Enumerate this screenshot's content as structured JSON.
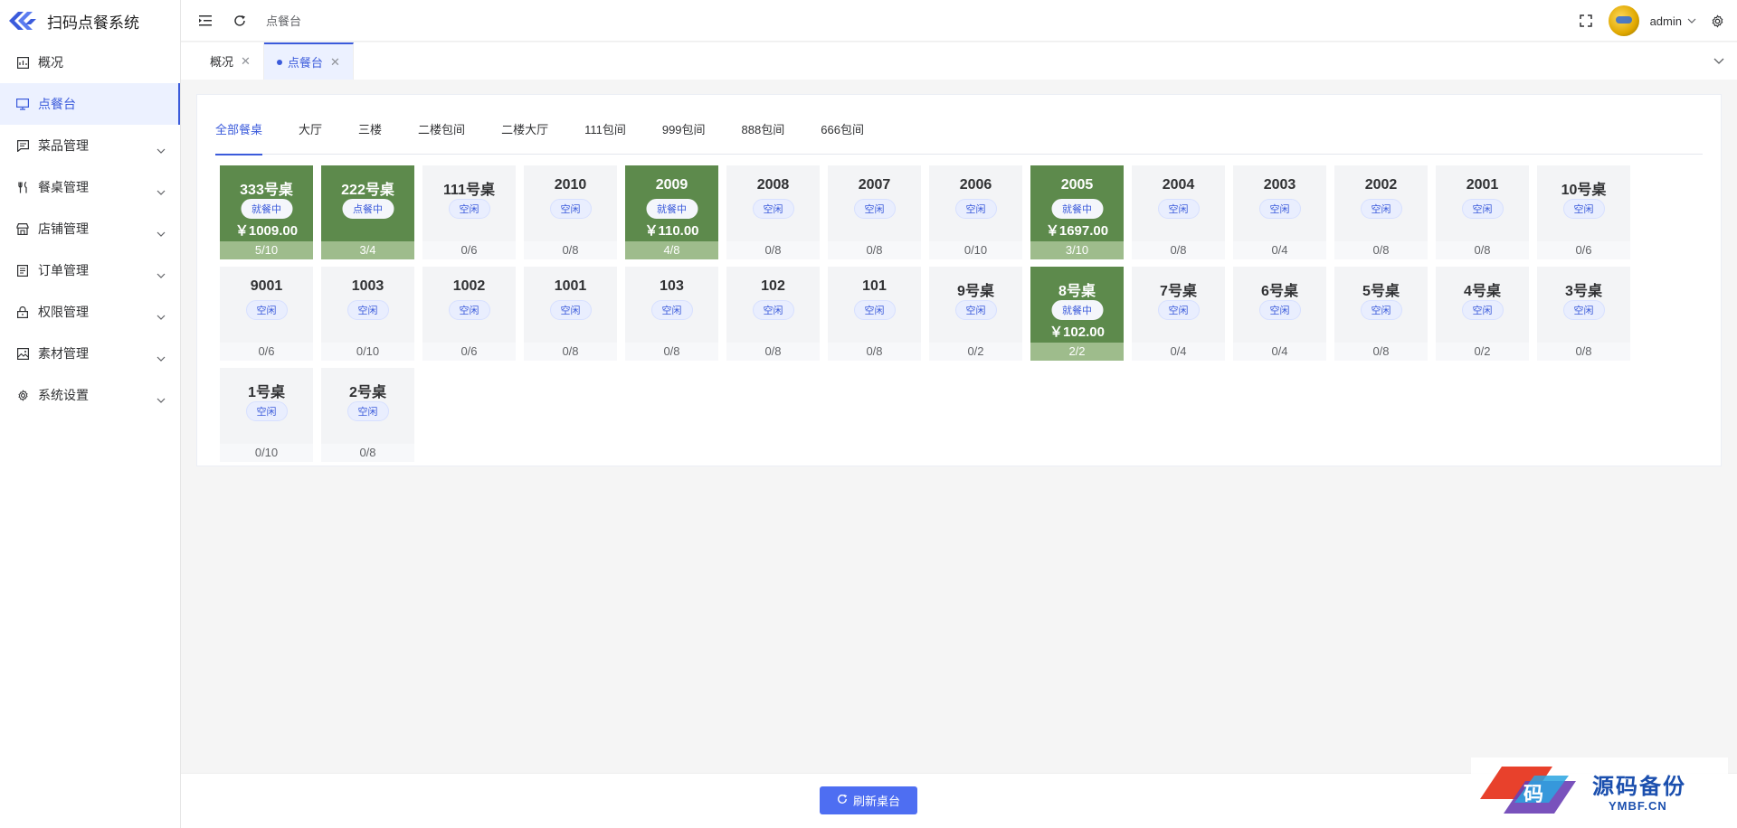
{
  "app": {
    "title": "扫码点餐系统"
  },
  "sidebar": {
    "items": [
      {
        "label": "概况",
        "icon": "dashboard-icon",
        "expandable": false,
        "active": false
      },
      {
        "label": "点餐台",
        "icon": "monitor-icon",
        "expandable": false,
        "active": true
      },
      {
        "label": "菜品管理",
        "icon": "menu-list-icon",
        "expandable": true,
        "active": false
      },
      {
        "label": "餐桌管理",
        "icon": "fork-knife-icon",
        "expandable": true,
        "active": false
      },
      {
        "label": "店铺管理",
        "icon": "shop-icon",
        "expandable": true,
        "active": false
      },
      {
        "label": "订单管理",
        "icon": "order-icon",
        "expandable": true,
        "active": false
      },
      {
        "label": "权限管理",
        "icon": "lock-icon",
        "expandable": true,
        "active": false
      },
      {
        "label": "素材管理",
        "icon": "image-icon",
        "expandable": true,
        "active": false
      },
      {
        "label": "系统设置",
        "icon": "gear-icon",
        "expandable": true,
        "active": false
      }
    ]
  },
  "header": {
    "breadcrumb": "点餐台",
    "username": "admin"
  },
  "tabs": [
    {
      "label": "概况",
      "active": false
    },
    {
      "label": "点餐台",
      "active": true
    }
  ],
  "areas": [
    "全部餐桌",
    "大厅",
    "三楼",
    "二楼包间",
    "二楼大厅",
    "111包间",
    "999包间",
    "888包间",
    "666包间"
  ],
  "active_area": "全部餐桌",
  "tables": [
    {
      "name": "333号桌",
      "status": "就餐中",
      "amount": "￥1009.00",
      "seats": "5/10",
      "busy": true
    },
    {
      "name": "222号桌",
      "status": "点餐中",
      "amount": "",
      "seats": "3/4",
      "busy": true
    },
    {
      "name": "111号桌",
      "status": "空闲",
      "amount": "",
      "seats": "0/6",
      "busy": false
    },
    {
      "name": "2010",
      "status": "空闲",
      "amount": "",
      "seats": "0/8",
      "busy": false
    },
    {
      "name": "2009",
      "status": "就餐中",
      "amount": "￥110.00",
      "seats": "4/8",
      "busy": true
    },
    {
      "name": "2008",
      "status": "空闲",
      "amount": "",
      "seats": "0/8",
      "busy": false
    },
    {
      "name": "2007",
      "status": "空闲",
      "amount": "",
      "seats": "0/8",
      "busy": false
    },
    {
      "name": "2006",
      "status": "空闲",
      "amount": "",
      "seats": "0/10",
      "busy": false
    },
    {
      "name": "2005",
      "status": "就餐中",
      "amount": "￥1697.00",
      "seats": "3/10",
      "busy": true
    },
    {
      "name": "2004",
      "status": "空闲",
      "amount": "",
      "seats": "0/8",
      "busy": false
    },
    {
      "name": "2003",
      "status": "空闲",
      "amount": "",
      "seats": "0/4",
      "busy": false
    },
    {
      "name": "2002",
      "status": "空闲",
      "amount": "",
      "seats": "0/8",
      "busy": false
    },
    {
      "name": "2001",
      "status": "空闲",
      "amount": "",
      "seats": "0/8",
      "busy": false
    },
    {
      "name": "10号桌",
      "status": "空闲",
      "amount": "",
      "seats": "0/6",
      "busy": false
    },
    {
      "name": "9001",
      "status": "空闲",
      "amount": "",
      "seats": "0/6",
      "busy": false
    },
    {
      "name": "1003",
      "status": "空闲",
      "amount": "",
      "seats": "0/10",
      "busy": false
    },
    {
      "name": "1002",
      "status": "空闲",
      "amount": "",
      "seats": "0/6",
      "busy": false
    },
    {
      "name": "1001",
      "status": "空闲",
      "amount": "",
      "seats": "0/8",
      "busy": false
    },
    {
      "name": "103",
      "status": "空闲",
      "amount": "",
      "seats": "0/8",
      "busy": false
    },
    {
      "name": "102",
      "status": "空闲",
      "amount": "",
      "seats": "0/8",
      "busy": false
    },
    {
      "name": "101",
      "status": "空闲",
      "amount": "",
      "seats": "0/8",
      "busy": false
    },
    {
      "name": "9号桌",
      "status": "空闲",
      "amount": "",
      "seats": "0/2",
      "busy": false
    },
    {
      "name": "8号桌",
      "status": "就餐中",
      "amount": "￥102.00",
      "seats": "2/2",
      "busy": true
    },
    {
      "name": "7号桌",
      "status": "空闲",
      "amount": "",
      "seats": "0/4",
      "busy": false
    },
    {
      "name": "6号桌",
      "status": "空闲",
      "amount": "",
      "seats": "0/4",
      "busy": false
    },
    {
      "name": "5号桌",
      "status": "空闲",
      "amount": "",
      "seats": "0/8",
      "busy": false
    },
    {
      "name": "4号桌",
      "status": "空闲",
      "amount": "",
      "seats": "0/2",
      "busy": false
    },
    {
      "name": "3号桌",
      "status": "空闲",
      "amount": "",
      "seats": "0/8",
      "busy": false
    },
    {
      "name": "1号桌",
      "status": "空闲",
      "amount": "",
      "seats": "0/10",
      "busy": false
    },
    {
      "name": "2号桌",
      "status": "空闲",
      "amount": "",
      "seats": "0/8",
      "busy": false
    }
  ],
  "footer": {
    "refresh_label": "刷新桌台"
  },
  "watermark": {
    "text": "源码备份",
    "sub": "YMBF.CN",
    "badge": "码"
  },
  "colors": {
    "accent": "#3b5bdb",
    "busy_table": "#5d8a4c",
    "busy_seats": "#9ebc8c",
    "idle_table": "#f3f4f6",
    "button": "#4e6ef2"
  }
}
